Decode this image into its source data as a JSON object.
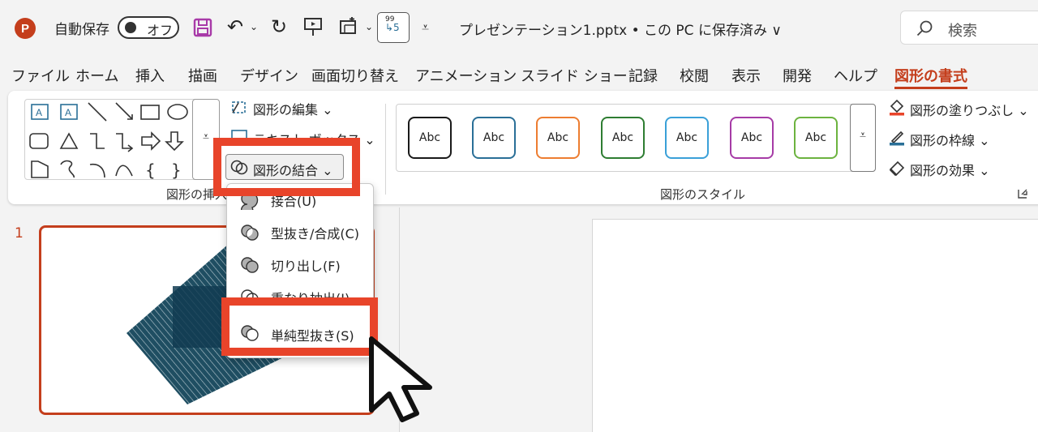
{
  "titlebar": {
    "app_logo": "P",
    "autosave_label": "自動保存",
    "autosave_state": "オフ",
    "numformat_icon_text": "99",
    "doc_title": "プレゼンテーション1.pptx • この PC に保存済み ∨",
    "search_placeholder": "検索"
  },
  "tabs": [
    {
      "label": "ファイル",
      "active": false
    },
    {
      "label": "ホーム",
      "active": false
    },
    {
      "label": "挿入",
      "active": false
    },
    {
      "label": "描画",
      "active": false
    },
    {
      "label": "デザイン",
      "active": false
    },
    {
      "label": "画面切り替え",
      "active": false
    },
    {
      "label": "アニメーション",
      "active": false
    },
    {
      "label": "スライド ショー",
      "active": false
    },
    {
      "label": "記録",
      "active": false
    },
    {
      "label": "校閲",
      "active": false
    },
    {
      "label": "表示",
      "active": false
    },
    {
      "label": "開発",
      "active": false
    },
    {
      "label": "ヘルプ",
      "active": false
    },
    {
      "label": "図形の書式",
      "active": true
    }
  ],
  "ribbon": {
    "edit_shape": "図形の編集 ⌄",
    "textbox": "テキスト ボックス ⌄",
    "merge_shapes": "図形の結合 ⌄",
    "insert_group_label": "図形の挿入",
    "styles_group_label": "図形のスタイル",
    "style_sample": "Abc",
    "style_colors": [
      "#1a1a1a",
      "#2a6f97",
      "#ed7d31",
      "#2e7d32",
      "#3aa0d8",
      "#a63ba6",
      "#6cb33f"
    ],
    "fill": "図形の塗りつぶし ⌄",
    "outline": "図形の枠線 ⌄",
    "effects": "図形の効果 ⌄"
  },
  "merge_menu": {
    "items": [
      {
        "label": "接合(U)"
      },
      {
        "label": "型抜き/合成(C)"
      },
      {
        "label": "切り出し(F)"
      },
      {
        "label": "重なり抽出(I)"
      },
      {
        "label": "単純型抜き(S)"
      }
    ]
  },
  "slides": {
    "current_number": "1"
  },
  "colors": {
    "accent": "#c43e1c",
    "highlight": "#e8442a",
    "shape_fill": "#1f4e62"
  }
}
